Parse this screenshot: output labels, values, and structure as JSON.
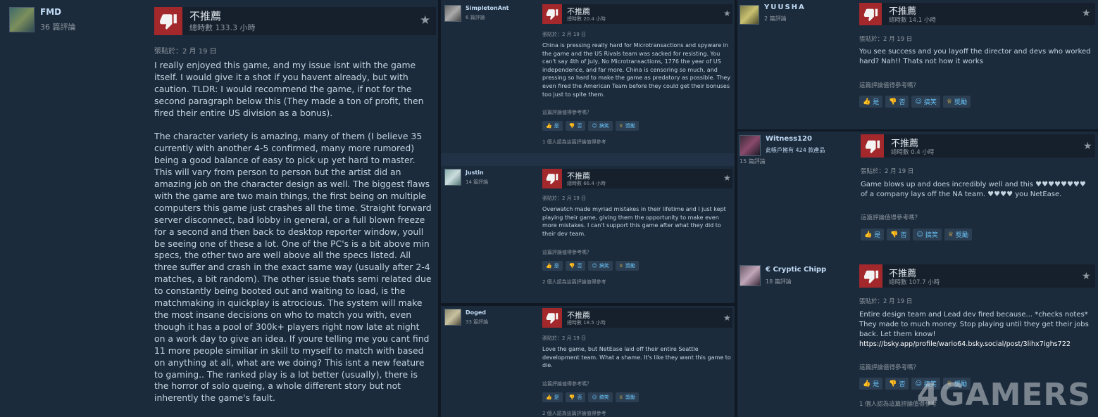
{
  "ui": {
    "verdict": "不推薦",
    "posted": "張貼於：2 月 19 日",
    "helpful_q": "這篇評論值得參考嗎？",
    "btn_yes": "是",
    "btn_no": "否",
    "btn_funny": "搞笑",
    "btn_award": "獎勵",
    "thumb_up_icon": "thumb-up-icon",
    "thumb_down_icon": "thumb-down-icon",
    "funny_icon": "smile-icon",
    "award_icon": "award-icon",
    "accent_red": "#a3282c",
    "link_blue": "#67c1f5"
  },
  "reviews": [
    {
      "user": "FMD",
      "count": "36 篇評論",
      "hours": "總時數 133.3 小時",
      "paragraphs": [
        "I really enjoyed this game, and my issue isnt with the game itself. I would give it a shot if you havent already, but with caution. TLDR: I would recommend the game, if not for the second paragraph below this (They made a ton of profit, then fired their entire US division as a bonus).",
        "The character variety is amazing, many of them (I believe 35 currently with another 4-5 confirmed, many more rumored) being a good balance of easy to pick up yet hard to master. This will vary from person to person but the artist did an amazing job on the character design as well. The biggest flaws with the game are two main things, the first being on multiple computers this game just crashes all the time. Straight forward server disconnect, bad lobby in general, or a full blown freeze for a second and then back to desktop reporter window, youll be seeing one of these a lot. One of the PC's is a bit above min specs, the other two are well above all the specs listed. All three suffer and crash in the exact same way (usually after 2-4 matches, a bit random). The other issue thats semi related due to constantly being booted out and waiting to load, is the matchmaking in quickplay is atrocious. The system will make the most insane decisions on who to match you with, even though it has a pool of 300k+ players right now late at night on a work day to give an idea. If youre telling me you cant find 11 more people similiar in skill to myself to match with based on anything at all, what are we doing? This isnt a new feature to gaming.. The ranked play is a lot better (usually), there is the horror of solo queing, a whole different story but not inherently the game's fault."
      ]
    },
    {
      "user": "SimpletonAnt",
      "count": "6 篇評論",
      "hours": "總時數 20.4 小時",
      "paragraphs": [
        "China is pressing really hard for Microtransactions and spyware in the game and the US Rivals team was sacked for resisting. You can't say 4th of July, No Microtransactions, 1776 the year of US independence, and far more. China is censoring so much, and pressing so hard to make the game as predatory as possible. They even fired the American Team before they could get their bonuses too just to spite them."
      ],
      "found": "1 個人認為這篇評論值得參考"
    },
    {
      "user": "Justin",
      "count": "14 篇評論",
      "hours": "總時數 66.4 小時",
      "paragraphs": [
        "Overwatch made myriad mistakes in their lifetime and I just kept playing their game, giving them the opportunity to make even more mistakes. I can't support this game after what they did to their dev team."
      ],
      "found": "2 個人認為這篇評論值得參考"
    },
    {
      "user": "Doged",
      "count": "33 篇評論",
      "hours": "總時數 18.5 小時",
      "paragraphs": [
        "Love the game, but NetEase laid off their entire Seattle development team. What a shame. It's like they want this game to die."
      ],
      "found": "2 個人認為這篇評論值得參考"
    },
    {
      "user": "YUUSHA",
      "count": "2 篇評論",
      "hours": "總時數 14.1 小時",
      "paragraphs": [
        "You see success and you layoff the director and devs who worked hard? Nah!! Thats not how it works"
      ]
    },
    {
      "user": "Witness120",
      "owned": "此帳戶擁有 424 款產品",
      "count": "15 篇評論",
      "hours": "總時數 0.4 小時",
      "paragraphs": [
        "Game blows up and does incredibly well and this ♥♥♥♥♥♥♥♥ of a company lays off the NA team. ♥♥♥♥ you NetEase."
      ]
    },
    {
      "user": "€ Cryptic Chipp",
      "count": "18 篇評論",
      "hours": "總時數 107.7 小時",
      "paragraphs": [
        "Entire design team and Lead dev fired because... *checks notes* They made to much money. Stop playing until they get their jobs back. Let them know!"
      ],
      "link": "https://bsky.app/profile/wario64.bsky.social/post/3lihx7ighs722",
      "found": "1 個人認為這篇評論值得參考"
    }
  ],
  "watermark": "4GAMERS"
}
